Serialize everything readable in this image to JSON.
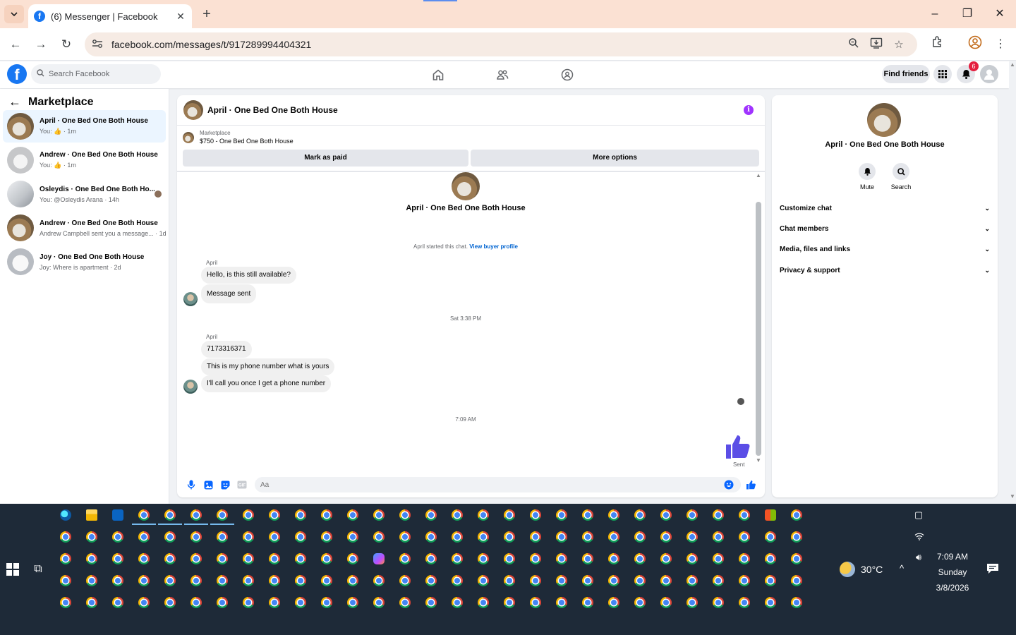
{
  "browser": {
    "tab_title": "(6) Messenger | Facebook",
    "url": "facebook.com/messages/t/917289994404321"
  },
  "fb_header": {
    "search_placeholder": "Search Facebook",
    "find_friends_label": "Find friends",
    "notification_count": "6"
  },
  "sidebar": {
    "title": "Marketplace",
    "conversations": [
      {
        "name": "April · One Bed One Both House",
        "snippet": "You: 👍 · 1m",
        "active": true
      },
      {
        "name": "Andrew · One Bed One Both House",
        "snippet": "You: 👍 · 1m",
        "active": false
      },
      {
        "name": "Osleydis · One Bed One Both Ho...",
        "snippet": "You: @Osleydis Arana · 14h",
        "active": false
      },
      {
        "name": "Andrew · One Bed One Both House",
        "snippet": "Andrew Campbell sent you a message... · 1d",
        "active": false
      },
      {
        "name": "Joy · One Bed One Both House",
        "snippet": "Joy: Where is apartment · 2d",
        "active": false
      }
    ]
  },
  "chat": {
    "title": "April · One Bed One Both House",
    "listing_label": "Marketplace",
    "listing_detail": "$750 - One Bed One Both House",
    "mark_paid_label": "Mark as paid",
    "more_options_label": "More options",
    "intro_name": "April · One Bed One Both House",
    "started_text": "April started this chat.",
    "view_profile_link": "View buyer profile",
    "groups": [
      {
        "sender": "April",
        "messages": [
          "Hello, is this still available?",
          "Message sent"
        ]
      },
      {
        "timestamp": "Sat 3:38 PM",
        "sender": "April",
        "messages": [
          "7173316371",
          "This is my phone number what is yours",
          "I'll call you once I get a phone number"
        ]
      }
    ],
    "timestamp_3": "7:09 AM",
    "sent_label": "Sent",
    "input_placeholder": "Aa"
  },
  "info_panel": {
    "name": "April · One Bed One Both House",
    "mute_label": "Mute",
    "search_label": "Search",
    "sections": [
      "Customize chat",
      "Chat members",
      "Media, files and links",
      "Privacy & support"
    ]
  },
  "taskbar": {
    "weather_temp": "30°C",
    "time": "7:09 AM",
    "day": "Sunday",
    "date": "3/8/2026"
  },
  "colors": {
    "facebook_blue": "#1877f2",
    "like_purple": "#5b4ee6",
    "info_purple": "#a033ff",
    "taskbar_bg": "#1e2a38"
  }
}
